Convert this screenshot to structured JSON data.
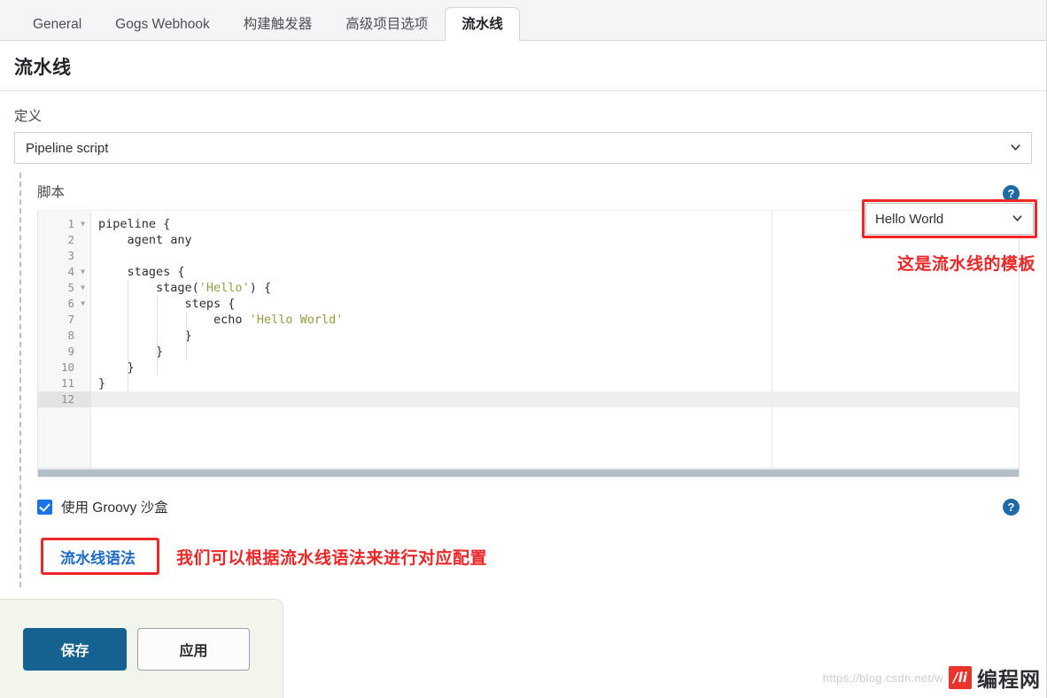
{
  "tabs": [
    {
      "label": "General",
      "active": false
    },
    {
      "label": "Gogs Webhook",
      "active": false
    },
    {
      "label": "构建触发器",
      "active": false
    },
    {
      "label": "高级项目选项",
      "active": false
    },
    {
      "label": "流水线",
      "active": true
    }
  ],
  "page": {
    "title": "流水线",
    "definition_label": "定义",
    "definition_value": "Pipeline script",
    "script_label": "脚本",
    "help_icon": "question-mark-icon",
    "chevron_icon": "chevron-down-icon"
  },
  "template_select": {
    "value": "Hello World",
    "annotation": "这是流水线的模板",
    "annotation_color": "#ef2626"
  },
  "editor": {
    "current_line": 12,
    "lines": [
      {
        "n": 1,
        "fold": true,
        "text": "pipeline {"
      },
      {
        "n": 2,
        "fold": false,
        "text": "    agent any"
      },
      {
        "n": 3,
        "fold": false,
        "text": ""
      },
      {
        "n": 4,
        "fold": true,
        "text": "    stages {"
      },
      {
        "n": 5,
        "fold": true,
        "text": "        stage('Hello') {"
      },
      {
        "n": 6,
        "fold": true,
        "text": "            steps {"
      },
      {
        "n": 7,
        "fold": false,
        "text": "                echo 'Hello World'"
      },
      {
        "n": 8,
        "fold": false,
        "text": "            }"
      },
      {
        "n": 9,
        "fold": false,
        "text": "        }"
      },
      {
        "n": 10,
        "fold": false,
        "text": "    }"
      },
      {
        "n": 11,
        "fold": false,
        "text": "}"
      },
      {
        "n": 12,
        "fold": false,
        "text": ""
      }
    ],
    "string_color": "#9c9a3f"
  },
  "sandbox": {
    "checked": true,
    "label": "使用 Groovy 沙盒"
  },
  "syntax": {
    "link_label": "流水线语法",
    "link_color": "#1b6ac9",
    "annotation": "我们可以根据流水线语法来进行对应配置"
  },
  "actions": {
    "save_label": "保存",
    "apply_label": "应用",
    "save_color": "#14628f"
  },
  "watermark": {
    "url": "https://blog.csdn.net/w",
    "logo_text": "/li",
    "site_name": "编程网"
  }
}
